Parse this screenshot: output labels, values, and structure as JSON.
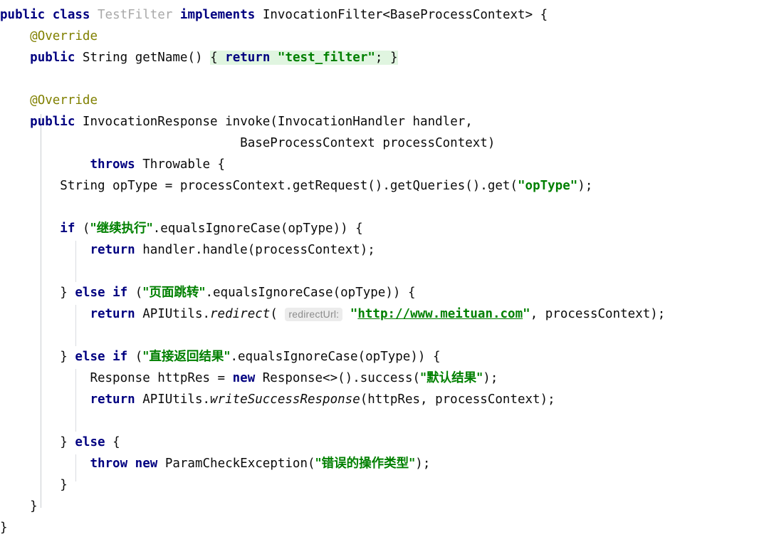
{
  "editor": {
    "kind": "code-editor",
    "language": "Java",
    "theme": "light",
    "colors": {
      "background": "#ffffff",
      "default_text": "#0b0b0b",
      "keyword": "#000080",
      "string": "#008000",
      "annotation": "#808000",
      "grayed_identifier": "#a9a9a9",
      "inlay_hint_text": "#8c8c8c",
      "inlay_hint_background": "#ececec",
      "brace_match_highlight": "#e0f5e0",
      "indent_guide": "#c9ccd1"
    }
  },
  "code": {
    "line01": {
      "kw_public": "public",
      "kw_class": "class",
      "class_name": "TestFilter",
      "kw_implements": "implements",
      "supertype": "InvocationFilter<BaseProcessContext>",
      "open_brace": "{"
    },
    "line02": {
      "annotation": "@Override"
    },
    "line03": {
      "kw_public": "public",
      "type": "String",
      "method": "getName()",
      "open_brace": "{",
      "kw_return": "return",
      "string": "\"test_filter\"",
      "semicolon": ";",
      "close_brace": "}"
    },
    "line05": {
      "annotation": "@Override"
    },
    "line06": {
      "kw_public": "public",
      "ret_type": "InvocationResponse",
      "method": "invoke(InvocationHandler handler,"
    },
    "line07": {
      "param": "BaseProcessContext processContext)"
    },
    "line08": {
      "kw_throws": "throws",
      "type": "Throwable {"
    },
    "line09": {
      "prefix": "String opType = processContext.getRequest().getQueries().get(",
      "string": "\"opType\"",
      "suffix": ");"
    },
    "line11": {
      "kw_if": "if",
      "open_paren": " (",
      "string": "\"继续执行\"",
      "suffix": ".equalsIgnoreCase(opType)) {"
    },
    "line12": {
      "kw_return": "return",
      "expr": " handler.handle(processContext);"
    },
    "line14": {
      "close_brace": "} ",
      "kw_else": "else",
      "kw_if": "if",
      "open_paren": " (",
      "string": "\"页面跳转\"",
      "suffix": ".equalsIgnoreCase(opType)) {"
    },
    "line15": {
      "kw_return": "return",
      "call_prefix": " APIUtils.",
      "method_italic": "redirect",
      "open_paren": "( ",
      "hint": "redirectUrl:",
      "quote_open": "\"",
      "url": "http://www.meituan.com",
      "quote_close": "\"",
      "suffix": ", processContext);"
    },
    "line17": {
      "close_brace": "} ",
      "kw_else": "else",
      "kw_if": "if",
      "open_paren": " (",
      "string": "\"直接返回结果\"",
      "suffix": ".equalsIgnoreCase(opType)) {"
    },
    "line18": {
      "prefix": "Response httpRes = ",
      "kw_new": "new",
      "mid": " Response<>().success(",
      "string": "\"默认结果\"",
      "suffix": ");"
    },
    "line19": {
      "kw_return": "return",
      "call_prefix": " APIUtils.",
      "method_italic": "writeSuccessResponse",
      "suffix": "(httpRes, processContext);"
    },
    "line21": {
      "close_brace": "} ",
      "kw_else": "else",
      "open_brace": " {"
    },
    "line22": {
      "kw_throw": "throw",
      "kw_new": "new",
      "exception": " ParamCheckException(",
      "string": "\"错误的操作类型\"",
      "suffix": ");"
    },
    "line23": {
      "close_brace": "}"
    },
    "line24": {
      "close_brace": "}"
    },
    "line25": {
      "close_brace": "}"
    }
  }
}
